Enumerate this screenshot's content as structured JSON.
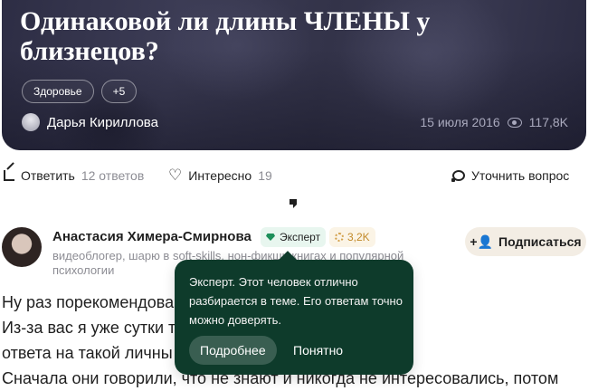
{
  "question": {
    "title": "Одинаковой ли длины ЧЛЕНЫ у близнецов?",
    "tags": [
      "Здоровье",
      "+5"
    ],
    "author": "Дарья Кириллова",
    "date": "15 июля 2016",
    "views": "117,8K"
  },
  "actions": {
    "answer_label": "Ответить",
    "answers_count": "12 ответов",
    "interesting_label": "Интересно",
    "interesting_count": "19",
    "clarify_label": "Уточнить вопрос"
  },
  "answer": {
    "author_name": "Анастасия Химера-Смирнова",
    "expert_badge": "Эксперт",
    "karma": "3,2K",
    "description": "видеоблогер, шарю в soft-skills, нон-фикшн книгах и популярной психологии",
    "subscribe_label": "Подписаться",
    "text_lines": [
      "Ну раз порекомендова                                              рос, то пожалуйста.",
      "Из-за вас я уже сутки т                                              лизнецов на предмет",
      "ответа на такой личны",
      "Сначала они говорили, что не знают и никогда не интересовались, потом"
    ]
  },
  "tooltip": {
    "text": "Эксперт. Этот человек отлично разбирается в теме. Его ответам точно можно доверять.",
    "more_label": "Подробнее",
    "ok_label": "Понятно"
  },
  "colors": {
    "tooltip_bg": "#0e3b2b",
    "expert_badge_bg": "#e8f6ef",
    "subscribe_bg": "#f3ede4"
  }
}
